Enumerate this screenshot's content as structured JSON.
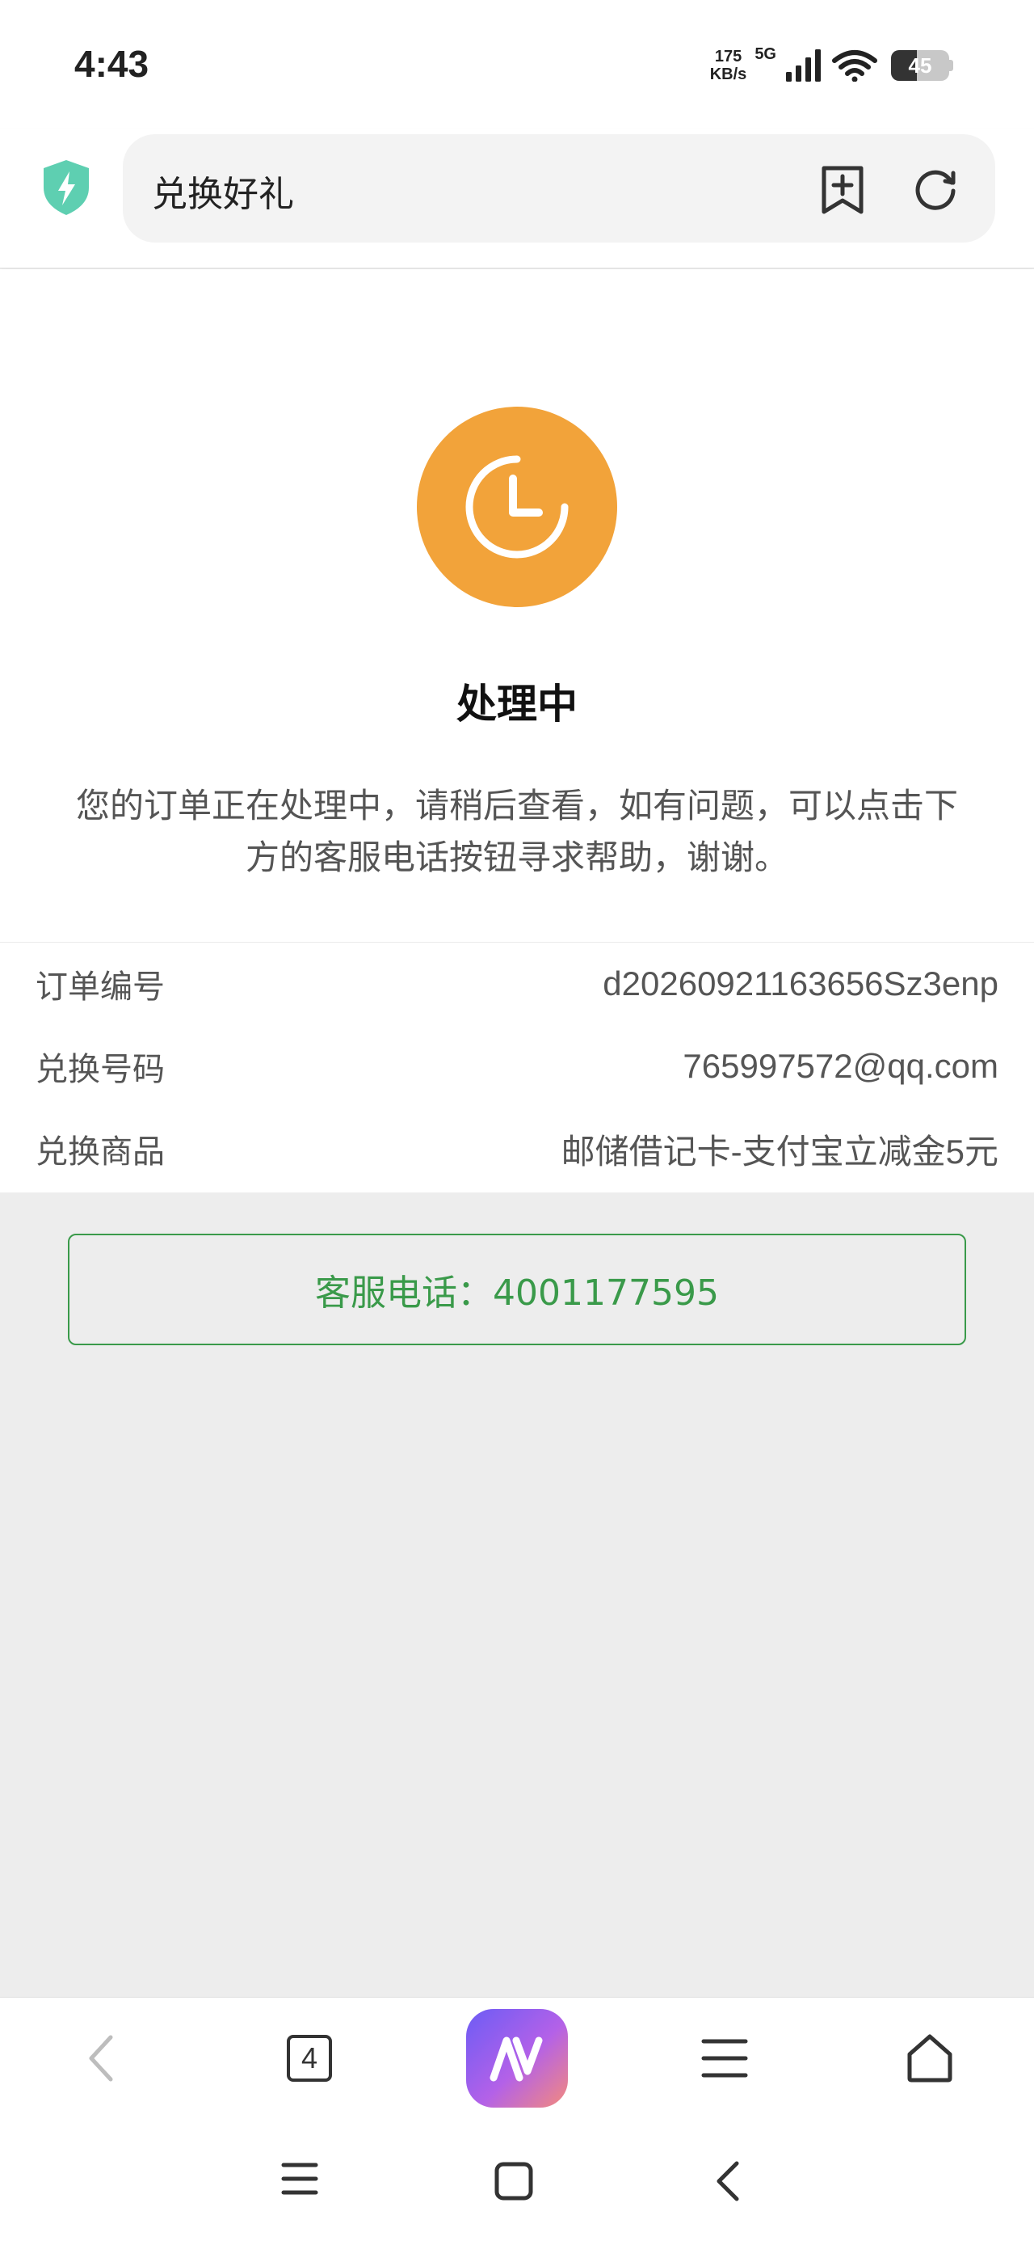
{
  "status_bar": {
    "time": "4:43",
    "net_speed_value": "175",
    "net_speed_unit": "KB/s",
    "network_type": "5G",
    "battery_level": 45,
    "battery_label": "45"
  },
  "browser": {
    "page_title": "兑换好礼",
    "shield_color": "#5ecfb1"
  },
  "order": {
    "status_title": "处理中",
    "status_description": "您的订单正在处理中，请稍后查看，如有问题，可以点击下方的客服电话按钮寻求帮助，谢谢。",
    "status_color": "#f2a33a",
    "rows": [
      {
        "label": "订单编号",
        "value": "d20260921163656Sz3enp"
      },
      {
        "label": "兑换号码",
        "value": "765997572@qq.com"
      },
      {
        "label": "兑换商品",
        "value": "邮储借记卡-支付宝立减金5元"
      }
    ],
    "service_button_label": "客服电话：4001177595",
    "accent_color": "#3a9a4a"
  },
  "bottom_nav": {
    "tab_count": "4",
    "items": [
      "back-icon",
      "tabs-icon",
      "ai-assistant-icon",
      "menu-icon",
      "home-icon"
    ]
  }
}
